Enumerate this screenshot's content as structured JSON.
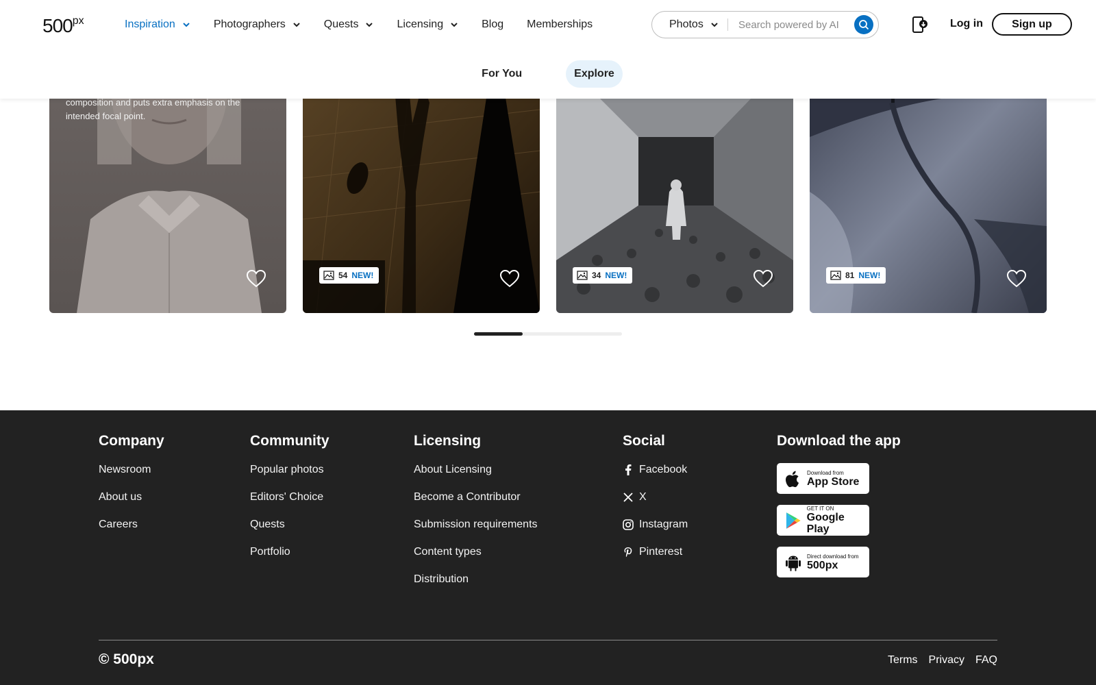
{
  "header": {
    "logo": "500",
    "logo_suffix": "px",
    "nav": [
      {
        "label": "Inspiration",
        "dropdown": true,
        "active": true
      },
      {
        "label": "Photographers",
        "dropdown": true
      },
      {
        "label": "Quests",
        "dropdown": true
      },
      {
        "label": "Licensing",
        "dropdown": true
      },
      {
        "label": "Blog",
        "dropdown": false
      },
      {
        "label": "Memberships",
        "dropdown": false
      }
    ],
    "search": {
      "type_selected": "Photos",
      "placeholder": "Search powered by AI"
    },
    "login_label": "Log in",
    "signup_label": "Sign up",
    "accent_color": "#0870c2"
  },
  "tabs": [
    {
      "label": "For You",
      "active": false
    },
    {
      "label": "Explore",
      "active": true
    }
  ],
  "gallery": {
    "cards": [
      {
        "description": "composition and puts extra emphasis on the intended focal point."
      },
      {
        "count": "54",
        "badge": "NEW!"
      },
      {
        "count": "34",
        "badge": "NEW!"
      },
      {
        "count": "81",
        "badge": "NEW!"
      }
    ],
    "scroll_progress": 0.33
  },
  "footer": {
    "company": {
      "title": "Company",
      "links": [
        "Newsroom",
        "About us",
        "Careers"
      ]
    },
    "community": {
      "title": "Community",
      "links": [
        "Popular photos",
        "Editors' Choice",
        "Quests",
        "Portfolio"
      ]
    },
    "licensing": {
      "title": "Licensing",
      "links": [
        "About Licensing",
        "Become a Contributor",
        "Submission requirements",
        "Content types",
        "Distribution"
      ]
    },
    "social": {
      "title": "Social",
      "links": [
        {
          "label": "Facebook",
          "icon": "facebook-icon"
        },
        {
          "label": "X",
          "icon": "x-icon"
        },
        {
          "label": "Instagram",
          "icon": "instagram-icon"
        },
        {
          "label": "Pinterest",
          "icon": "pinterest-icon"
        }
      ]
    },
    "app": {
      "title": "Download the app",
      "badges": [
        {
          "small": "Download from",
          "big": "App Store",
          "icon": "apple-icon"
        },
        {
          "small": "GET IT ON",
          "big": "Google Play",
          "icon": "google-play-icon"
        },
        {
          "small": "Direct download from",
          "big": "500px",
          "icon": "android-icon"
        }
      ]
    },
    "copyright": "© 500px",
    "legal": [
      "Terms",
      "Privacy",
      "FAQ"
    ],
    "background": "#222222"
  }
}
